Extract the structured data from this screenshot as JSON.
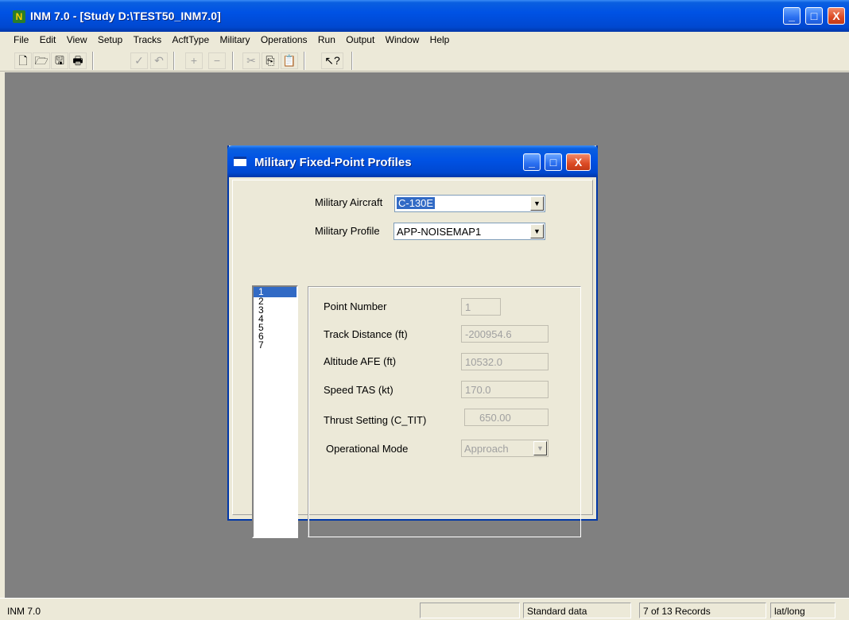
{
  "window": {
    "app_icon": "N",
    "title": "INM 7.0  - [Study D:\\TEST50_INM7.0]",
    "minimize_glyph": "_",
    "maximize_glyph": "□",
    "close_glyph": "X"
  },
  "menu": [
    "File",
    "Edit",
    "View",
    "Setup",
    "Tracks",
    "AcftType",
    "Military",
    "Operations",
    "Run",
    "Output",
    "Window",
    "Help"
  ],
  "toolbar": {
    "new_icon": "🗋",
    "open_icon": "🗁",
    "save_icon": "🖫",
    "print_icon": "🖶",
    "commit_icon": "✓",
    "undo_icon": "↶",
    "add_icon": "+",
    "remove_icon": "−",
    "cut_icon": "✂",
    "copy_icon": "⎘",
    "paste_icon": "📋",
    "help_icon": "↖?"
  },
  "dialog": {
    "title": "Military Fixed-Point Profiles",
    "aircraft_label": "Military Aircraft",
    "aircraft_value": "C-130E",
    "profile_label": "Military Profile",
    "profile_value": "APP-NOISEMAP1",
    "points": [
      "1",
      "2",
      "3",
      "4",
      "5",
      "6",
      "7"
    ],
    "selected_point": "1",
    "fields": {
      "point_number_label": "Point Number",
      "point_number_value": "1",
      "track_distance_label": "Track Distance (ft)",
      "track_distance_value": "-200954.6",
      "altitude_label": "Altitude AFE  (ft)",
      "altitude_value": "10532.0",
      "speed_label": "Speed  TAS  (kt)",
      "speed_value": "170.0",
      "thrust_label": "Thrust Setting (C_TIT)",
      "thrust_value": "650.00",
      "mode_label": "Operational Mode",
      "mode_value": "Approach"
    }
  },
  "status": {
    "app": "INM 7.0",
    "data": "Standard data",
    "records": "7 of 13 Records",
    "coords": "lat/long"
  }
}
